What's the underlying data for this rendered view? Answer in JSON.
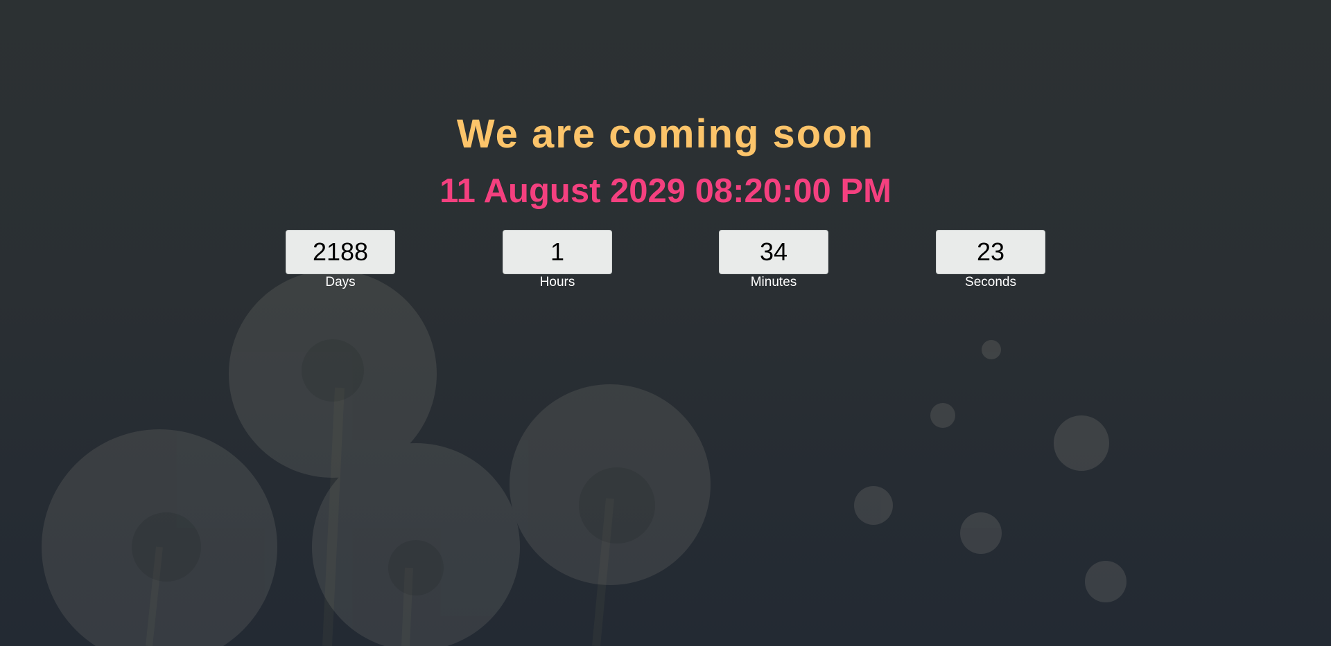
{
  "theme": {
    "title_color": "#fcc46a",
    "subtitle_color": "#f4407f"
  },
  "heading": {
    "title": "We are coming soon",
    "date": "11 August 2029 08:20:00 PM"
  },
  "countdown": [
    {
      "value": "2188",
      "label": "Days"
    },
    {
      "value": "1",
      "label": "Hours"
    },
    {
      "value": "34",
      "label": "Minutes"
    },
    {
      "value": "23",
      "label": "Seconds"
    }
  ]
}
